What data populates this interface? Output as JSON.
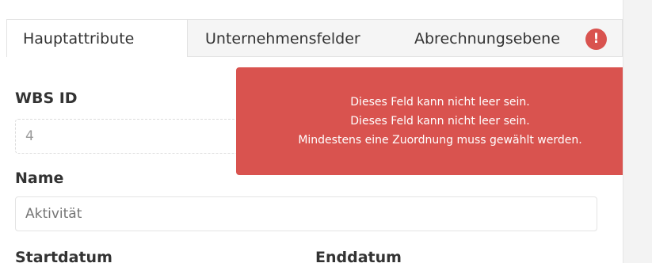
{
  "tabs": [
    {
      "label": "Hauptattribute",
      "active": true
    },
    {
      "label": "Unternehmensfelder",
      "active": false
    },
    {
      "label": "Abrechnungsebene",
      "active": false,
      "has_error": true
    }
  ],
  "tab_error_icon": "!",
  "form": {
    "wbs_id": {
      "label": "WBS ID",
      "value": "4"
    },
    "name": {
      "label": "Name",
      "placeholder": "Aktivität"
    },
    "start_label": "Startdatum",
    "end_label": "Enddatum"
  },
  "error_tooltip": {
    "messages": [
      "Dieses Feld kann nicht leer sein.",
      "Dieses Feld kann nicht leer sein.",
      "Mindestens eine Zuordnung muss gewählt werden."
    ]
  },
  "colors": {
    "error": "#d9534f",
    "tab_inactive_bg": "#f5f5f5",
    "border": "#e2e2e2"
  }
}
